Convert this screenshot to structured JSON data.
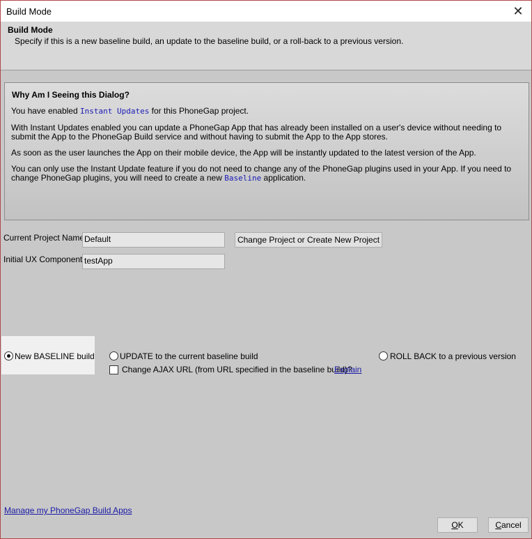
{
  "window": {
    "title": "Build Mode"
  },
  "header": {
    "title": "Build Mode",
    "description": "Specify if this is a new baseline build, an update to the baseline build, or a roll-back to a previous version."
  },
  "info": {
    "title": "Why Am I Seeing this Dialog?",
    "p1_pre": "You have enabled ",
    "p1_code": "Instant Updates",
    "p1_post": " for this PhoneGap project.",
    "p2": "With Instant Updates enabled you can update a PhoneGap App that has already been installed on a user's device without needing to submit the App to the PhoneGap Build service and without having to submit the App to the App stores.",
    "p3": "As soon as the user launches the App on their mobile device, the App will be instantly updated to the latest version of the App.",
    "p4_pre": "You can only use the Instant Update feature if you do not need to change any of the PhoneGap plugins used in your App. If you need to change PhoneGap plugins, you will need to create a new ",
    "p4_code": "Baseline",
    "p4_post": " application."
  },
  "form": {
    "project_label": "Current Project Name:",
    "project_value": "Default",
    "change_project_button": "Change Project or Create New Project",
    "ux_label": "Initial UX Component:",
    "ux_value": "testApp"
  },
  "modes": {
    "baseline_label": "New BASELINE build",
    "update_label": "UPDATE to the current baseline build",
    "rollback_label": "ROLL BACK to a previous version",
    "selected": "baseline",
    "ajax_label": "Change AJAX URL (from URL specified in the baseline build)?",
    "ajax_checked": false,
    "explain_link": "Explain"
  },
  "footer": {
    "manage_link": "Manage my PhoneGap Build Apps",
    "ok_first": "O",
    "ok_rest": "K",
    "cancel_first": "C",
    "cancel_rest": "ancel"
  }
}
